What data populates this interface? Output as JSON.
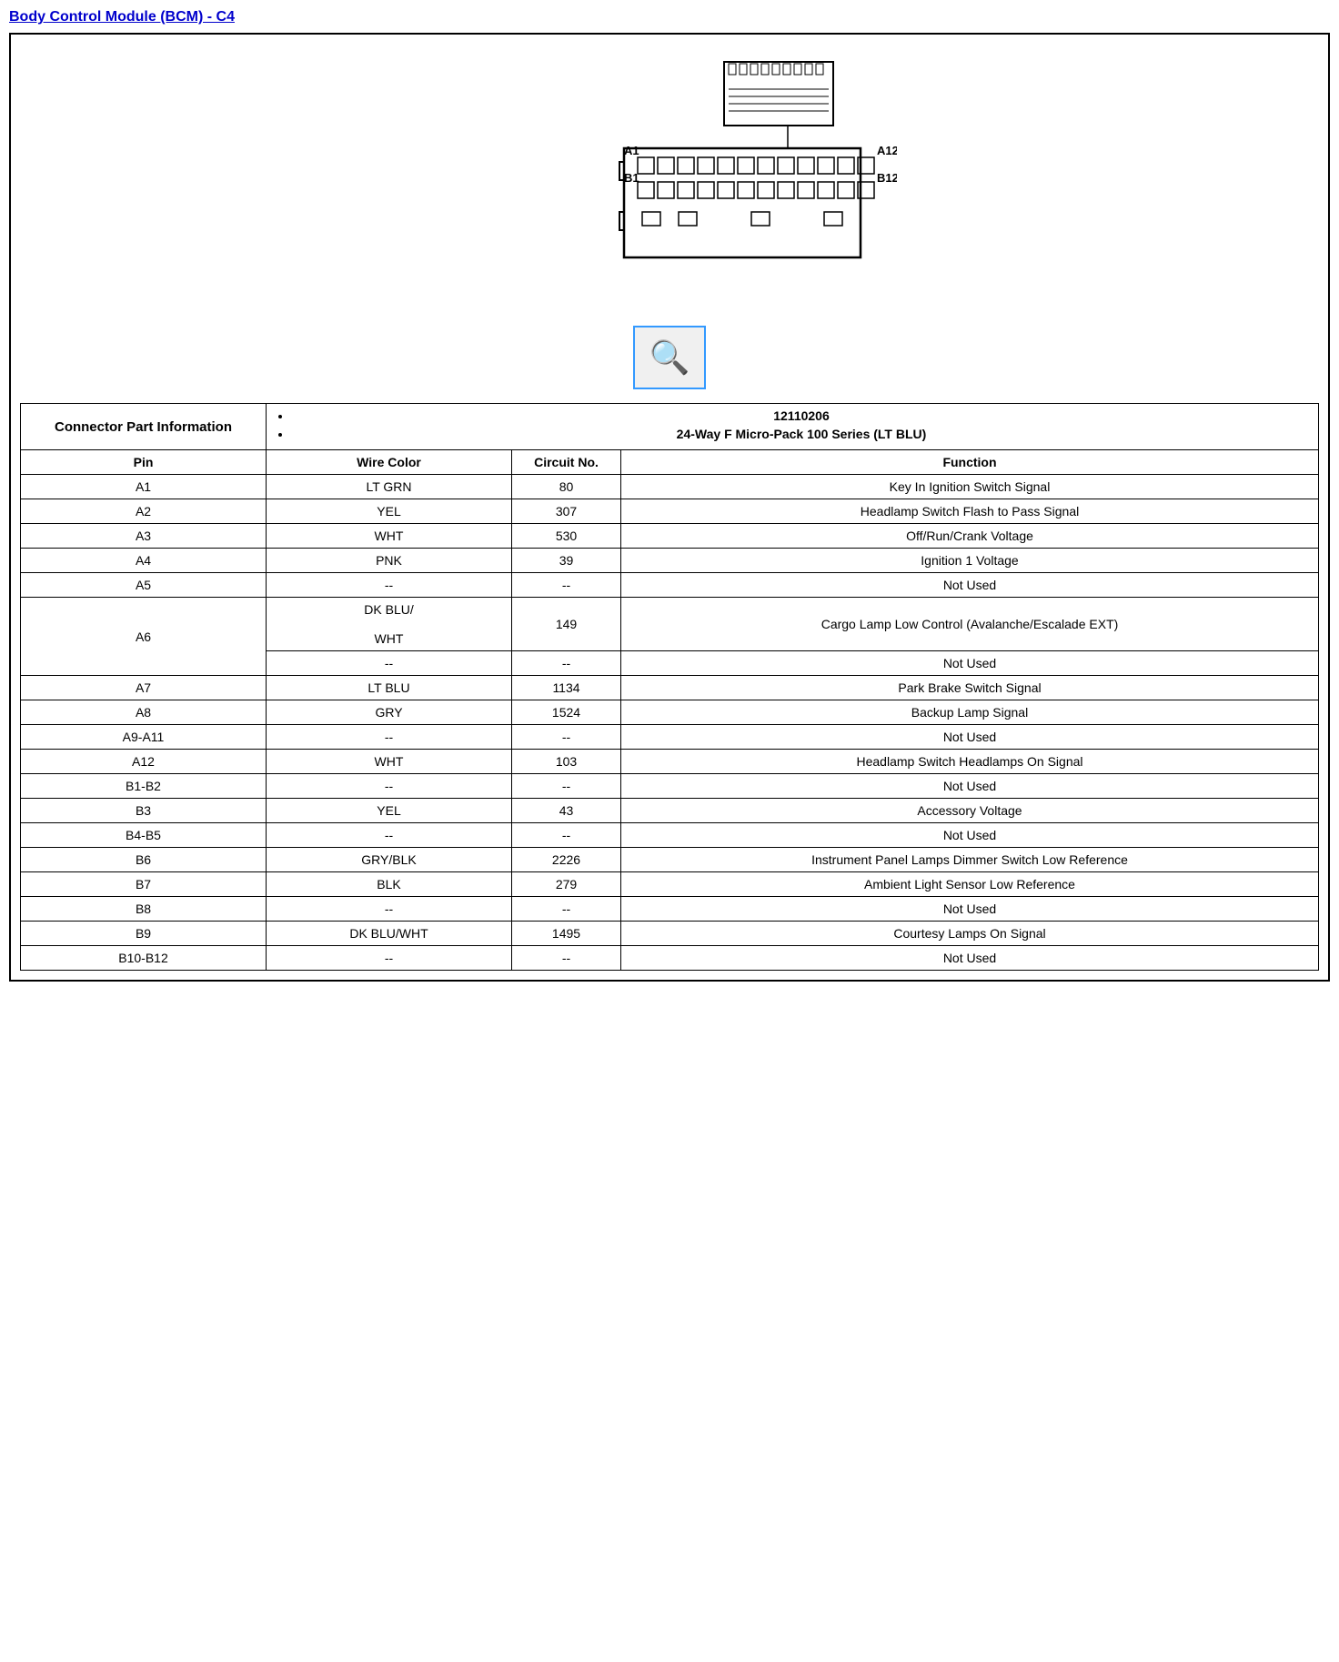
{
  "title": "Body Control Module (BCM) - C4",
  "connector_info": {
    "label": "Connector Part Information",
    "items": [
      "12110206",
      "24-Way F Micro-Pack 100 Series (LT BLU)"
    ]
  },
  "table_headers": {
    "pin": "Pin",
    "wire_color": "Wire Color",
    "circuit_no": "Circuit No.",
    "function": "Function"
  },
  "rows": [
    {
      "pin": "A1",
      "wire_color": "LT GRN",
      "circuit_no": "80",
      "function": "Key In Ignition Switch Signal"
    },
    {
      "pin": "A2",
      "wire_color": "YEL",
      "circuit_no": "307",
      "function": "Headlamp Switch Flash to Pass Signal"
    },
    {
      "pin": "A3",
      "wire_color": "WHT",
      "circuit_no": "530",
      "function": "Off/Run/Crank Voltage"
    },
    {
      "pin": "A4",
      "wire_color": "PNK",
      "circuit_no": "39",
      "function": "Ignition 1 Voltage"
    },
    {
      "pin": "A5",
      "wire_color": "--",
      "circuit_no": "--",
      "function": "Not Used"
    },
    {
      "pin": "A6",
      "wire_color": "DK BLU/\n\nWHT",
      "circuit_no": "149",
      "function": "Cargo Lamp Low Control (Avalanche/Escalade EXT)",
      "extra_row": true
    },
    {
      "pin": "",
      "wire_color": "--",
      "circuit_no": "--",
      "function": "Not Used",
      "no_pin": true
    },
    {
      "pin": "A7",
      "wire_color": "LT BLU",
      "circuit_no": "1134",
      "function": "Park Brake Switch Signal"
    },
    {
      "pin": "A8",
      "wire_color": "GRY",
      "circuit_no": "1524",
      "function": "Backup Lamp Signal"
    },
    {
      "pin": "A9-A11",
      "wire_color": "--",
      "circuit_no": "--",
      "function": "Not Used"
    },
    {
      "pin": "A12",
      "wire_color": "WHT",
      "circuit_no": "103",
      "function": "Headlamp Switch Headlamps On Signal"
    },
    {
      "pin": "B1-B2",
      "wire_color": "--",
      "circuit_no": "--",
      "function": "Not Used"
    },
    {
      "pin": "B3",
      "wire_color": "YEL",
      "circuit_no": "43",
      "function": "Accessory Voltage"
    },
    {
      "pin": "B4-B5",
      "wire_color": "--",
      "circuit_no": "--",
      "function": "Not Used"
    },
    {
      "pin": "B6",
      "wire_color": "GRY/BLK",
      "circuit_no": "2226",
      "function": "Instrument Panel Lamps Dimmer Switch Low Reference"
    },
    {
      "pin": "B7",
      "wire_color": "BLK",
      "circuit_no": "279",
      "function": "Ambient Light Sensor Low Reference"
    },
    {
      "pin": "B8",
      "wire_color": "--",
      "circuit_no": "--",
      "function": "Not Used"
    },
    {
      "pin": "B9",
      "wire_color": "DK BLU/WHT",
      "circuit_no": "1495",
      "function": "Courtesy Lamps On Signal"
    },
    {
      "pin": "B10-B12",
      "wire_color": "--",
      "circuit_no": "--",
      "function": "Not Used"
    }
  ]
}
